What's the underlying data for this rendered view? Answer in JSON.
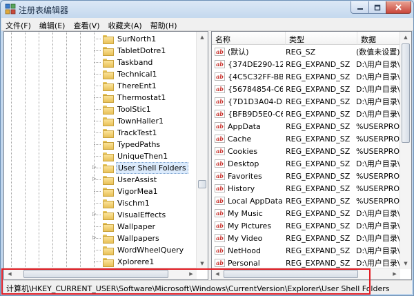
{
  "window": {
    "title": "注册表编辑器"
  },
  "menu": [
    "文件(F)",
    "编辑(E)",
    "查看(V)",
    "收藏夹(A)",
    "帮助(H)"
  ],
  "tree": {
    "items": [
      {
        "label": "SurNorth1",
        "expandable": false
      },
      {
        "label": "TabletDotre1",
        "expandable": false
      },
      {
        "label": "Taskband",
        "expandable": false
      },
      {
        "label": "Technical1",
        "expandable": false
      },
      {
        "label": "ThereEnt1",
        "expandable": false
      },
      {
        "label": "Thermostat1",
        "expandable": false
      },
      {
        "label": "ToolStic1",
        "expandable": false
      },
      {
        "label": "TownHaller1",
        "expandable": false
      },
      {
        "label": "TrackTest1",
        "expandable": false
      },
      {
        "label": "TypedPaths",
        "expandable": false
      },
      {
        "label": "UniqueThen1",
        "expandable": false
      },
      {
        "label": "User Shell Folders",
        "expandable": true,
        "selected": true
      },
      {
        "label": "UserAssist",
        "expandable": true
      },
      {
        "label": "VigorMea1",
        "expandable": false
      },
      {
        "label": "Vischm1",
        "expandable": false
      },
      {
        "label": "VisualEffects",
        "expandable": true
      },
      {
        "label": "Wallpaper",
        "expandable": false
      },
      {
        "label": "Wallpapers",
        "expandable": true
      },
      {
        "label": "WordWheelQuery",
        "expandable": false
      },
      {
        "label": "Xplorere1",
        "expandable": false
      }
    ]
  },
  "list": {
    "columns": [
      "名称",
      "类型",
      "数据"
    ],
    "rows": [
      {
        "name": "(默认)",
        "type": "REG_SZ",
        "data": "(数值未设置)"
      },
      {
        "name": "{374DE290-12...",
        "type": "REG_EXPAND_SZ",
        "data": "D:\\用户目录\\"
      },
      {
        "name": "{4C5C32FF-BB...",
        "type": "REG_EXPAND_SZ",
        "data": "D:\\用户目录\\"
      },
      {
        "name": "{56784854-C6...",
        "type": "REG_EXPAND_SZ",
        "data": "D:\\用户目录\\"
      },
      {
        "name": "{7D1D3A04-DE...",
        "type": "REG_EXPAND_SZ",
        "data": "D:\\用户目录\\"
      },
      {
        "name": "{BFB9D5E0-C6...",
        "type": "REG_EXPAND_SZ",
        "data": "D:\\用户目录\\"
      },
      {
        "name": "AppData",
        "type": "REG_EXPAND_SZ",
        "data": "%USERPROF"
      },
      {
        "name": "Cache",
        "type": "REG_EXPAND_SZ",
        "data": "%USERPROF"
      },
      {
        "name": "Cookies",
        "type": "REG_EXPAND_SZ",
        "data": "%USERPROF"
      },
      {
        "name": "Desktop",
        "type": "REG_EXPAND_SZ",
        "data": "D:\\用户目录\\"
      },
      {
        "name": "Favorites",
        "type": "REG_EXPAND_SZ",
        "data": "%USERPROF"
      },
      {
        "name": "History",
        "type": "REG_EXPAND_SZ",
        "data": "%USERPROF"
      },
      {
        "name": "Local AppData",
        "type": "REG_EXPAND_SZ",
        "data": "%USERPROF"
      },
      {
        "name": "My Music",
        "type": "REG_EXPAND_SZ",
        "data": "D:\\用户目录\\"
      },
      {
        "name": "My Pictures",
        "type": "REG_EXPAND_SZ",
        "data": "D:\\用户目录\\"
      },
      {
        "name": "My Video",
        "type": "REG_EXPAND_SZ",
        "data": "D:\\用户目录\\"
      },
      {
        "name": "NetHood",
        "type": "REG_EXPAND_SZ",
        "data": "D:\\用户目录\\"
      },
      {
        "name": "Personal",
        "type": "REG_EXPAND_SZ",
        "data": "D:\\用户目录\\"
      }
    ]
  },
  "status": {
    "path": "计算机\\HKEY_CURRENT_USER\\Software\\Microsoft\\Windows\\CurrentVersion\\Explorer\\User Shell Folders"
  },
  "icons": {
    "value_icon": "ab",
    "folder": "folder-icon"
  },
  "colors": {
    "highlight": "#e31d24",
    "selection": "#dcebfc",
    "value_icon_text": "#c8322d"
  }
}
